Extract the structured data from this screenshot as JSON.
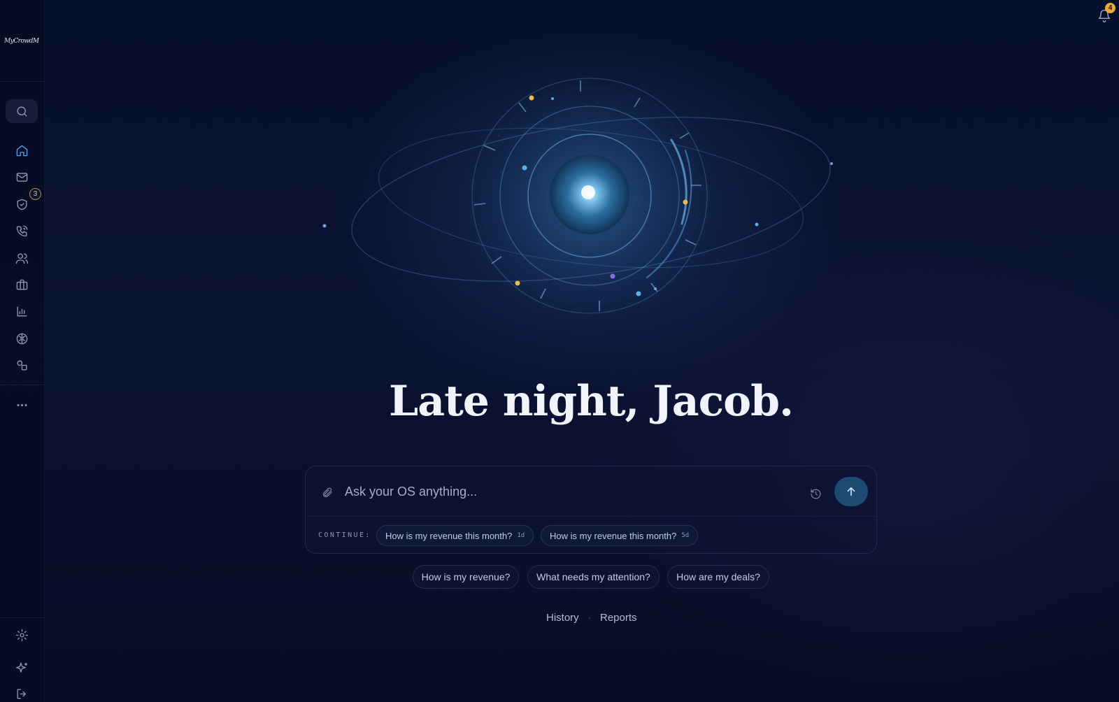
{
  "brand": {
    "logo_text": "MyCrowdMoni"
  },
  "sidebar": {
    "items": [
      {
        "name": "search",
        "icon": "search-icon"
      },
      {
        "name": "home",
        "icon": "home-icon",
        "active": true
      },
      {
        "name": "inbox",
        "icon": "mail-icon"
      },
      {
        "name": "approvals",
        "icon": "shield-check-icon",
        "badge": "3"
      },
      {
        "name": "calls",
        "icon": "phone-icon"
      },
      {
        "name": "contacts",
        "icon": "users-icon"
      },
      {
        "name": "deals",
        "icon": "briefcase-icon"
      },
      {
        "name": "analytics",
        "icon": "bar-chart-icon"
      },
      {
        "name": "brain",
        "icon": "brain-icon"
      },
      {
        "name": "workflows",
        "icon": "shapes-icon"
      },
      {
        "name": "more",
        "icon": "more-horizontal-icon"
      }
    ],
    "bottom": [
      {
        "name": "settings",
        "icon": "gear-icon"
      },
      {
        "name": "ai",
        "icon": "sparkles-icon"
      },
      {
        "name": "logout",
        "icon": "logout-icon"
      }
    ]
  },
  "notifications": {
    "count": "4",
    "icon": "bell-icon"
  },
  "hero": {
    "greeting": "Late night, Jacob."
  },
  "prompt": {
    "placeholder": "Ask your OS anything...",
    "continue_label": "CONTINUE:",
    "recent": [
      {
        "text": "How is my revenue this month?",
        "age": "1d"
      },
      {
        "text": "How is my revenue this month?",
        "age": "5d"
      }
    ]
  },
  "suggestions": [
    "How is my revenue?",
    "What needs my attention?",
    "How are my deals?"
  ],
  "footer": {
    "history": "History",
    "separator": "·",
    "reports": "Reports"
  },
  "colors": {
    "accent": "#4fa6e8",
    "badge": "#e9a93b",
    "send": "#1f4a72",
    "background": "#0a1232"
  }
}
